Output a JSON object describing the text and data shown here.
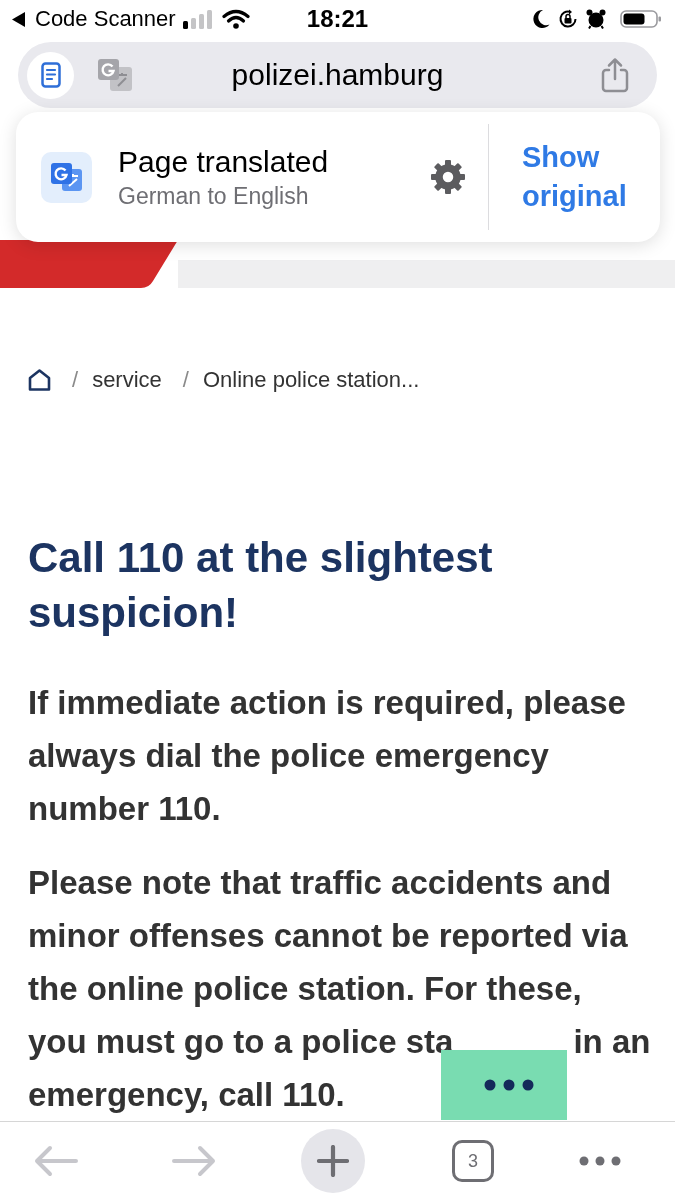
{
  "status_bar": {
    "back_app": "Code Scanner",
    "time": "18:21"
  },
  "address_bar": {
    "url": "polizei.hamburg"
  },
  "translate_banner": {
    "title": "Page translated",
    "subtitle": "German to English",
    "action": "Show original"
  },
  "breadcrumb": [
    {
      "kind": "home"
    },
    {
      "kind": "separator",
      "text": "/"
    },
    {
      "kind": "link",
      "text": "service"
    },
    {
      "kind": "separator",
      "text": "/"
    },
    {
      "kind": "link",
      "text": "Online police station..."
    }
  ],
  "article": {
    "heading": "Call 110 at the slightest suspicion!",
    "paragraphs": [
      {
        "parts": [
          "If immediate action is required, please always dial the police emergency number 110."
        ]
      },
      {
        "parts": [
          "Please note that traffic accidents and minor offenses cannot be reported via the online police station. For these,\nyou must go to a police sta",
          "in an emergency, call 110."
        ]
      }
    ]
  },
  "toolbar": {
    "buttons": [
      {
        "kind": "back",
        "disabled": true
      },
      {
        "kind": "forward",
        "disabled": true
      },
      {
        "kind": "new_tab",
        "disabled": false
      },
      {
        "kind": "tabs",
        "label": "3",
        "disabled": false
      },
      {
        "kind": "menu",
        "disabled": false
      }
    ]
  }
}
